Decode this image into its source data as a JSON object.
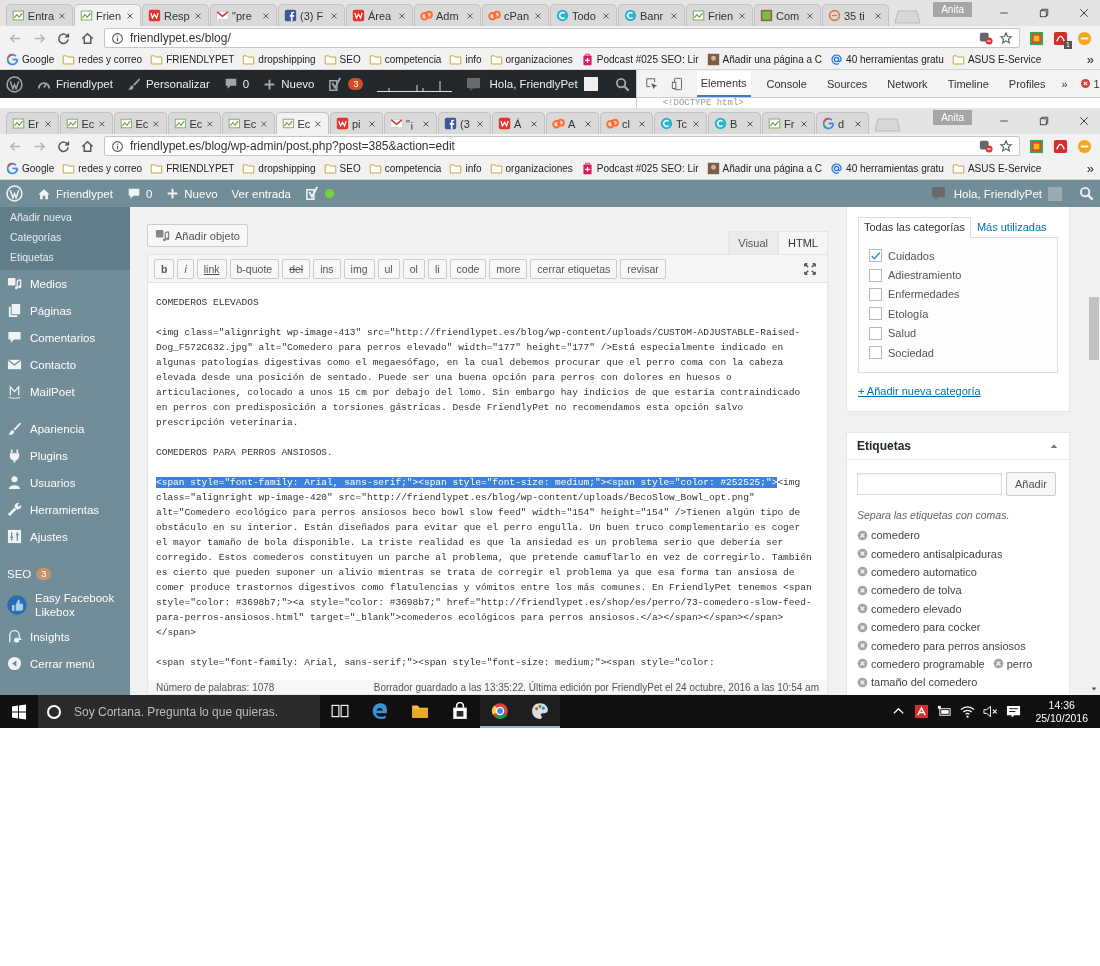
{
  "windows": [
    {
      "tabs": [
        {
          "label": "Entra",
          "kind": "fp",
          "selected": false
        },
        {
          "label": "Frien",
          "kind": "fp",
          "selected": true
        },
        {
          "label": "Resp",
          "kind": "w",
          "selected": false
        },
        {
          "label": "\"pre",
          "kind": "gmail",
          "selected": false
        },
        {
          "label": "(3) F",
          "kind": "fb",
          "selected": false
        },
        {
          "label": "Área",
          "kind": "w",
          "selected": false
        },
        {
          "label": "Adm",
          "kind": "cp",
          "selected": false
        },
        {
          "label": "cPan",
          "kind": "cp",
          "selected": false
        },
        {
          "label": "Todo",
          "kind": "c",
          "selected": false
        },
        {
          "label": "Banr",
          "kind": "c",
          "selected": false
        },
        {
          "label": "Frien",
          "kind": "fp",
          "selected": false
        },
        {
          "label": "Com",
          "kind": "img",
          "selected": false
        },
        {
          "label": "35 ti",
          "kind": "ring",
          "selected": false
        }
      ],
      "profile": "Anita",
      "address": "friendlypet.es/blog/",
      "extensions": [
        {
          "kind": "multicolor"
        },
        {
          "kind": "pdf",
          "badge": "1"
        },
        {
          "kind": "minus"
        }
      ],
      "bookmarks": [
        {
          "kind": "google",
          "label": "Google"
        },
        {
          "kind": "folder",
          "label": "redes y correo"
        },
        {
          "kind": "folder",
          "label": "FRIENDLYPET"
        },
        {
          "kind": "folder",
          "label": "dropshipping"
        },
        {
          "kind": "folder",
          "label": "SEO"
        },
        {
          "kind": "folder",
          "label": "competencia"
        },
        {
          "kind": "folder",
          "label": "info"
        },
        {
          "kind": "folder",
          "label": "organizaciones"
        },
        {
          "kind": "podcast",
          "label": "Podcast #025 SEO: Lir"
        },
        {
          "kind": "page",
          "label": "Añadir una página a C"
        },
        {
          "kind": "at",
          "label": "40 herramientas gratu"
        },
        {
          "kind": "folder",
          "label": "ASUS E-Service"
        }
      ],
      "bookmarks_more": "»",
      "admin_bar": {
        "items": [
          {
            "kind": "logo"
          },
          {
            "kind": "dashboard",
            "label": "Friendlypet"
          },
          {
            "kind": "customize",
            "label": "Personalizar"
          },
          {
            "kind": "comments",
            "label": "0"
          },
          {
            "kind": "new",
            "label": "Nuevo"
          },
          {
            "kind": "seo",
            "badge": "3"
          },
          {
            "kind": "ruler"
          }
        ],
        "greeting": "Hola, FriendlyPet"
      },
      "devtools": {
        "tabs": [
          {
            "label": "Elements",
            "selected": true
          },
          {
            "label": "Console",
            "selected": false
          },
          {
            "label": "Sources",
            "selected": false
          },
          {
            "label": "Network",
            "selected": false
          },
          {
            "label": "Timeline",
            "selected": false
          },
          {
            "label": "Profiles",
            "selected": false
          }
        ],
        "more": "»",
        "errors": "1",
        "source_line": "<!DOCTYPE html>"
      }
    },
    {
      "tabs": [
        {
          "label": "Er",
          "kind": "fp",
          "selected": false
        },
        {
          "label": "Ec",
          "kind": "fp",
          "selected": false
        },
        {
          "label": "Ec",
          "kind": "fp",
          "selected": false
        },
        {
          "label": "Ec",
          "kind": "fp",
          "selected": false
        },
        {
          "label": "Ec",
          "kind": "fp",
          "selected": false
        },
        {
          "label": "Ec",
          "kind": "fp",
          "selected": true
        },
        {
          "label": "pi",
          "kind": "w",
          "selected": false
        },
        {
          "label": "\"¡",
          "kind": "gmail",
          "selected": false
        },
        {
          "label": "(3",
          "kind": "fb",
          "selected": false
        },
        {
          "label": "Á",
          "kind": "w",
          "selected": false
        },
        {
          "label": "A",
          "kind": "cp",
          "selected": false
        },
        {
          "label": "cl",
          "kind": "cp",
          "selected": false
        },
        {
          "label": "Tc",
          "kind": "c",
          "selected": false
        },
        {
          "label": "B",
          "kind": "c",
          "selected": false
        },
        {
          "label": "Fr",
          "kind": "fp",
          "selected": false
        },
        {
          "label": "d",
          "kind": "google",
          "selected": false
        }
      ],
      "profile": "Anita",
      "address": "friendlypet.es/blog/wp-admin/post.php?post=385&action=edit",
      "extensions": [
        {
          "kind": "multicolor"
        },
        {
          "kind": "pdf"
        },
        {
          "kind": "minus"
        }
      ],
      "bookmarks": [
        {
          "kind": "google",
          "label": "Google"
        },
        {
          "kind": "folder",
          "label": "redes y correo"
        },
        {
          "kind": "folder",
          "label": "FRIENDLYPET"
        },
        {
          "kind": "folder",
          "label": "dropshipping"
        },
        {
          "kind": "folder",
          "label": "SEO"
        },
        {
          "kind": "folder",
          "label": "competencia"
        },
        {
          "kind": "folder",
          "label": "info"
        },
        {
          "kind": "folder",
          "label": "organizaciones"
        },
        {
          "kind": "podcast",
          "label": "Podcast #025 SEO: Lir"
        },
        {
          "kind": "page",
          "label": "Añadir una página a C"
        },
        {
          "kind": "at",
          "label": "40 herramientas gratu"
        },
        {
          "kind": "folder",
          "label": "ASUS E-Service"
        }
      ],
      "bookmarks_more": "»",
      "admin_bar": {
        "items": [
          {
            "kind": "logo"
          },
          {
            "kind": "home",
            "label": "Friendlypet"
          },
          {
            "kind": "comments",
            "label": "0"
          },
          {
            "kind": "new",
            "label": "Nuevo"
          },
          {
            "kind": "link",
            "label": "Ver entrada"
          },
          {
            "kind": "seo",
            "color": "#7ad03a"
          }
        ],
        "greeting": "Hola, FriendlyPet"
      }
    }
  ],
  "sidebar": {
    "submenu": [
      "Añadir nueva",
      "Categorías",
      "Etiquetas"
    ],
    "groups": [
      [
        {
          "kind": "media",
          "label": "Medios"
        },
        {
          "kind": "pages",
          "label": "Páginas"
        },
        {
          "kind": "comments",
          "label": "Comentarios"
        },
        {
          "kind": "mail",
          "label": "Contacto"
        },
        {
          "kind": "mailpoet",
          "label": "MailPoet"
        }
      ],
      [
        {
          "kind": "appearance",
          "label": "Apariencia"
        },
        {
          "kind": "plugins",
          "label": "Plugins"
        },
        {
          "kind": "users",
          "label": "Usuarios"
        },
        {
          "kind": "tools",
          "label": "Herramientas"
        },
        {
          "kind": "settings",
          "label": "Ajustes"
        }
      ],
      [
        {
          "kind": "seo",
          "label": "SEO",
          "badge": "3"
        },
        {
          "kind": "likebox",
          "label": "Easy Facebook Likebox"
        },
        {
          "kind": "insights",
          "label": "Insights"
        },
        {
          "kind": "collapse",
          "label": "Cerrar menú"
        }
      ]
    ]
  },
  "editor": {
    "add_media": "Añadir objeto",
    "tabs": [
      {
        "label": "Visual",
        "selected": false
      },
      {
        "label": "HTML",
        "selected": true
      }
    ],
    "quicktags": [
      {
        "label": "b",
        "kind": "bold"
      },
      {
        "label": "i",
        "kind": "italic"
      },
      {
        "label": "link",
        "kind": "underline"
      },
      {
        "label": "b-quote",
        "kind": "plain"
      },
      {
        "label": "del",
        "kind": "strike"
      },
      {
        "label": "ins",
        "kind": "plain"
      },
      {
        "label": "img",
        "kind": "plain"
      },
      {
        "label": "ul",
        "kind": "plain"
      },
      {
        "label": "ol",
        "kind": "plain"
      },
      {
        "label": "li",
        "kind": "plain"
      },
      {
        "label": "code",
        "kind": "plain"
      },
      {
        "label": "more",
        "kind": "plain"
      },
      {
        "label": "cerrar etiquetas",
        "kind": "plain"
      },
      {
        "label": "revisar",
        "kind": "plain"
      }
    ],
    "paragraphs": [
      {
        "lines": [
          "COMEDEROS ELEVADOS"
        ]
      },
      {
        "lines": [
          "<img class=\"alignright wp-image-413\" src=\"http://friendlypet.es/blog/wp-content/uploads/CUSTOM-ADJUSTABLE-Raised-",
          "Dog_F572C632.jpg\" alt=\"Comedero para perros elevado\" width=\"177\" height=\"177\" />Está especialmente indicado en",
          "algunas patologías digestivas como el megaesófago, en la cual debemos procurar que el perro coma con la cabeza",
          "elevada desde una posición de sentado. Puede ser una buena opción para perros con dolores en huesos o",
          "articulaciones, colocado a unos 15 cm por debajo del lomo. Sin embargo hay indicios de que estaría contraindicado",
          "en perros con predisposición a torsiones gástricas. Desde FriendlyPet no recomendamos esta opción salvo",
          "prescripción veterinaria."
        ]
      },
      {
        "lines": [
          "COMEDEROS PARA PERROS ANSIOSOS."
        ]
      },
      {
        "selection": "<span style=\"font-family: Arial, sans-serif;\"><span style=\"font-size: medium;\"><span style=\"color: #252525;\">",
        "lines": [
          "<img",
          "class=\"alignright wp-image-420\" src=\"http://friendlypet.es/blog/wp-content/uploads/BecoSlow_Bowl_opt.png\"",
          "alt=\"Comedero ecológico para perros ansiosos beco bowl slow feed\" width=\"154\" height=\"154\" />Tienen algún tipo de",
          "obstáculo en su interior. Están diseñados para evitar que el perro engulla. Un buen truco complementario es coger",
          "el mayor tamaño de bola disponible. La triste realidad es que la ansiedad es un problema serio que debería ser",
          "corregido. Estos comederos constituyen un parche al problema, que pretende camuflarlo en vez de corregirlo. También",
          "es cierto que pueden suponer un alivio mientras se trata de corregir el problema ya que esa forma tan ansiosa de",
          "comer produce trastornos digestivos como flatulencias y vómitos entre los más comunes. En FriendlyPet tenemos <span",
          "style=\"color: #3698b7;\"><a style=\"color: #3698b7;\" href=\"http://friendlypet.es/shop/es/perro/73-comedero-slow-feed-",
          "para-perros-ansiosos.html\" target=\"_blank\">comederos ecológicos para perros ansiosos.</a></span></span></span>",
          "</span>"
        ]
      },
      {
        "lines": [
          "<span style=\"font-family: Arial, sans-serif;\"><span style=\"font-size: medium;\"><span style=\"color:"
        ]
      }
    ],
    "word_count": "Número de palabras: 1078",
    "status": "Borrador guardado a las 13:35:22. Última edición por FriendlyPet el 24 octubre, 2016 a las 10:54 am"
  },
  "categories": {
    "tabs": [
      {
        "label": "Todas las categorías",
        "selected": true
      },
      {
        "label": "Más utilizadas",
        "selected": false
      }
    ],
    "items": [
      {
        "label": "Cuidados",
        "checked": true
      },
      {
        "label": "Adiestramiento",
        "checked": false
      },
      {
        "label": "Enfermedades",
        "checked": false
      },
      {
        "label": "Etología",
        "checked": false
      },
      {
        "label": "Salud",
        "checked": false
      },
      {
        "label": "Sociedad",
        "checked": false
      }
    ],
    "add_link": "+ Añadir nueva categoría"
  },
  "tags_box": {
    "title": "Etiquetas",
    "expanded": true,
    "button": "Añadir",
    "hint": "Separa las etiquetas con comas.",
    "tags": [
      "comedero",
      "comedero antisalpicaduras",
      "comedero automatico",
      "comedero de tolva",
      "comedero elevado",
      "comedero para cocker",
      "comedero para perros ansiosos",
      "comedero programable",
      "perro",
      "tamaño del comedero"
    ]
  },
  "taskbar": {
    "search": {
      "placeholder": "Soy Cortana. Pregunta lo que quieras."
    },
    "apps": [
      {
        "kind": "task-view",
        "active": false
      },
      {
        "kind": "edge",
        "active": false
      },
      {
        "kind": "explorer",
        "active": false
      },
      {
        "kind": "store",
        "active": false
      },
      {
        "kind": "chrome",
        "active": true
      },
      {
        "kind": "paint",
        "active": true
      }
    ],
    "tray": [
      {
        "kind": "chevron"
      },
      {
        "kind": "antivirus"
      },
      {
        "kind": "battery"
      },
      {
        "kind": "wifi"
      },
      {
        "kind": "volume-muted"
      },
      {
        "kind": "notifications"
      }
    ],
    "time": "14:36",
    "date": "25/10/2016"
  }
}
